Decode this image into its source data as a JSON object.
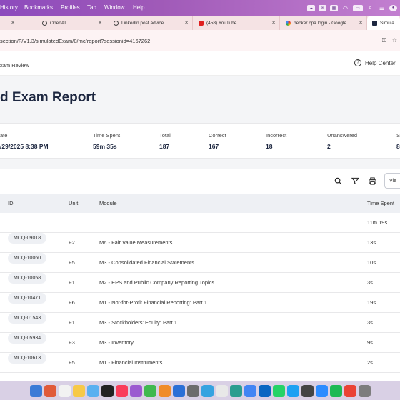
{
  "menubar": {
    "items": [
      "History",
      "Bookmarks",
      "Profiles",
      "Tab",
      "Window",
      "Help"
    ],
    "status_icons": [
      "cloud-icon",
      "mail-icon",
      "cpu-icon",
      "wifi-icon",
      "battery-icon",
      "search-icon",
      "control-center-icon",
      "siri-icon"
    ]
  },
  "tabs": [
    {
      "label": "",
      "icon": "generic",
      "color": "#b0b0b0"
    },
    {
      "label": "OpenAI",
      "icon": "openai-icon",
      "color": "#444444"
    },
    {
      "label": "LinkedIn post advice",
      "icon": "openai-icon",
      "color": "#444444"
    },
    {
      "label": "(458) YouTube",
      "icon": "youtube-icon",
      "color": "#e02020"
    },
    {
      "label": "becker cpa login - Google",
      "icon": "google-icon",
      "color": "#4285f4"
    },
    {
      "label": "Simula",
      "icon": "becker-icon",
      "color": "#1d2740"
    }
  ],
  "url": "section/F/V1.3/simulatedExam/0/mc/report?sessionid=4167262",
  "header": {
    "breadcrumb": "xam Review",
    "help_label": "Help Center"
  },
  "page_title": "d Exam Report",
  "stats": [
    {
      "label": "ate",
      "value": "/29/2025 8:38 PM"
    },
    {
      "label": "Time Spent",
      "value": "59m 35s"
    },
    {
      "label": "Total",
      "value": "187"
    },
    {
      "label": "Correct",
      "value": "167"
    },
    {
      "label": "Incorrect",
      "value": "18"
    },
    {
      "label": "Unanswered",
      "value": "2"
    },
    {
      "label": "S",
      "value": "8"
    }
  ],
  "toolbar": {
    "view_label": "Vie"
  },
  "table": {
    "columns": [
      "ID",
      "Unit",
      "Module",
      "Time Spent"
    ],
    "summary_time": "11m 19s",
    "rows": [
      {
        "id": "MCQ-09018",
        "unit": "F2",
        "module": "M6 - Fair Value Measurements",
        "time": "13s"
      },
      {
        "id": "MCQ-10060",
        "unit": "F5",
        "module": "M3 - Consolidated Financial Statements",
        "time": "10s"
      },
      {
        "id": "MCQ-10058",
        "unit": "F1",
        "module": "M2 - EPS and Public Company Reporting Topics",
        "time": "3s"
      },
      {
        "id": "MCQ-10471",
        "unit": "F6",
        "module": "M1 - Not-for-Profit Financial Reporting: Part 1",
        "time": "19s"
      },
      {
        "id": "MCQ-01543",
        "unit": "F1",
        "module": "M3 - Stockholders' Equity: Part 1",
        "time": "3s"
      },
      {
        "id": "MCQ-05934",
        "unit": "F3",
        "module": "M3 - Inventory",
        "time": "9s"
      },
      {
        "id": "MCQ-10613",
        "unit": "F5",
        "module": "M1 - Financial Instruments",
        "time": "2s"
      }
    ]
  }
}
